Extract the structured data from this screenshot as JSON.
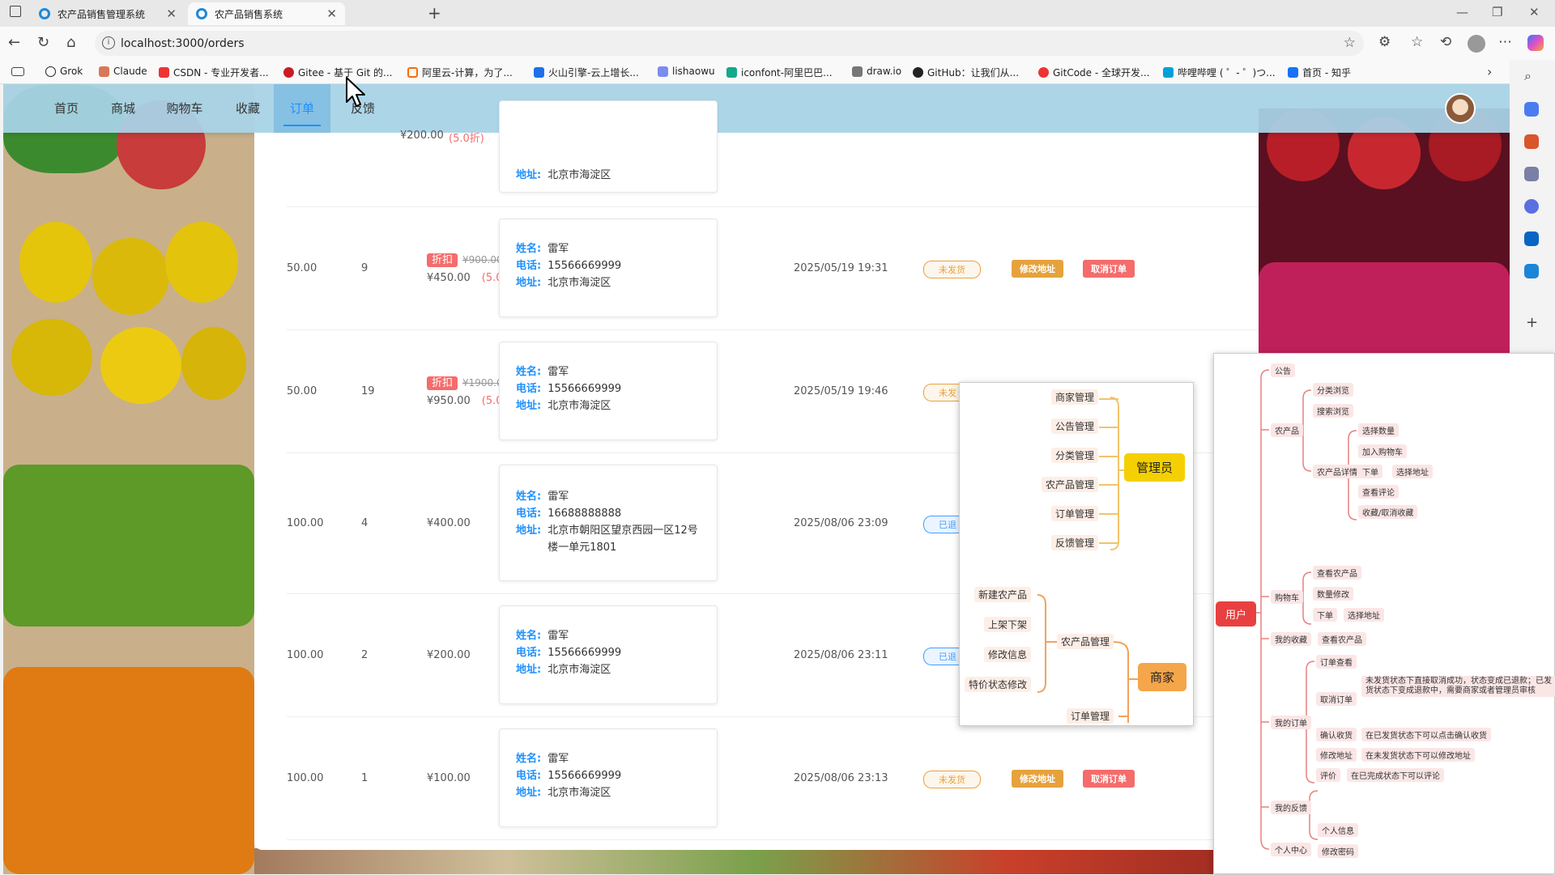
{
  "browser": {
    "tabs": [
      {
        "title": "农产品销售管理系统",
        "active": false
      },
      {
        "title": "农产品销售系统",
        "active": true
      }
    ],
    "url": "localhost:3000/orders",
    "bookmarks": [
      "Grok",
      "Claude",
      "CSDN - 专业开发者...",
      "Gitee - 基于 Git 的...",
      "阿里云-计算，为了...",
      "火山引擎-云上增长...",
      "lishaowu",
      "iconfont-阿里巴巴...",
      "draw.io",
      "GitHub：让我们从...",
      "GitCode - 全球开发...",
      "哔哩哔哩 ( ゜- ゜)つ...",
      "首页 - 知乎"
    ]
  },
  "nav": {
    "items": [
      "首页",
      "商城",
      "购物车",
      "收藏",
      "订单",
      "反馈"
    ],
    "active_index": 4
  },
  "orders": {
    "labels": {
      "name": "姓名:",
      "phone": "电话:",
      "address": "地址:"
    },
    "top_partial": {
      "price": "¥200.00",
      "rate": "(5.0折)",
      "address": "北京市海淀区"
    },
    "rows": [
      {
        "unit_price": "50.00",
        "qty": "9",
        "discount_tag": "折扣",
        "original": "¥900.00",
        "final": "¥450.00",
        "rate": "(5.0折)",
        "name": "雷军",
        "phone": "15566669999",
        "address": "北京市海淀区",
        "time": "2025/05/19 19:31",
        "status": "未发货",
        "status_type": "pending",
        "actions": [
          "修改地址",
          "取消订单"
        ]
      },
      {
        "unit_price": "50.00",
        "qty": "19",
        "discount_tag": "折扣",
        "original": "¥1900.00",
        "final": "¥950.00",
        "rate": "(5.0折)",
        "name": "雷军",
        "phone": "15566669999",
        "address": "北京市海淀区",
        "time": "2025/05/19 19:46",
        "status": "未发",
        "status_type": "pending",
        "actions": []
      },
      {
        "unit_price": "100.00",
        "qty": "4",
        "discount_tag": "",
        "original": "",
        "final": "¥400.00",
        "rate": "",
        "name": "雷军",
        "phone": "16688888888",
        "address": "北京市朝阳区望京西园一区12号楼一单元1801",
        "time": "2025/08/06 23:09",
        "status": "已退",
        "status_type": "returned",
        "actions": []
      },
      {
        "unit_price": "100.00",
        "qty": "2",
        "discount_tag": "",
        "original": "",
        "final": "¥200.00",
        "rate": "",
        "name": "雷军",
        "phone": "15566669999",
        "address": "北京市海淀区",
        "time": "2025/08/06 23:11",
        "status": "已退",
        "status_type": "returned",
        "actions": []
      },
      {
        "unit_price": "100.00",
        "qty": "1",
        "discount_tag": "",
        "original": "",
        "final": "¥100.00",
        "rate": "",
        "name": "雷军",
        "phone": "15566669999",
        "address": "北京市海淀区",
        "time": "2025/08/06 23:13",
        "status": "未发货",
        "status_type": "pending",
        "actions": [
          "修改地址",
          "取消订单"
        ]
      }
    ]
  },
  "mindmap_admin": {
    "admin_root": "管理员",
    "admin_children": [
      "商家管理",
      "公告管理",
      "分类管理",
      "农产品管理",
      "订单管理",
      "反馈管理"
    ],
    "merchant_root": "商家",
    "merchant_children": [
      "农产品管理",
      "订单管理"
    ],
    "product_children": [
      "新建农产品",
      "上架下架",
      "修改信息",
      "特价状态修改"
    ]
  },
  "mindmap_user": {
    "root": "用户",
    "nodes": {
      "notice": "公告",
      "products": "农产品",
      "browse_cat": "分类浏览",
      "browse_search": "搜索浏览",
      "detail": "农产品详情",
      "sel_qty": "选择数量",
      "add_cart": "加入购物车",
      "order": "下单",
      "sel_addr": "选择地址",
      "view_review": "查看评论",
      "fav": "收藏/取消收藏",
      "cart": "购物车",
      "cart_view": "查看农产品",
      "cart_qty": "数量修改",
      "cart_order": "下单",
      "cart_addr": "选择地址",
      "my_fav": "我的收藏",
      "fav_view": "查看农产品",
      "my_orders": "我的订单",
      "o_view": "订单查看",
      "o_cancel": "取消订单",
      "o_cancel_note": "未发货状态下直接取消成功，状态变成已退款；已发货状态下变成退款中，需要商家或者管理员审核",
      "o_confirm": "确认收货",
      "o_confirm_note": "在已发货状态下可以点击确认收货",
      "o_addr": "修改地址",
      "o_addr_note": "在未发货状态下可以修改地址",
      "o_review": "评价",
      "o_review_note": "在已完成状态下可以评论",
      "my_feedback": "我的反馈",
      "center": "个人中心",
      "info": "个人信息",
      "pwd": "修改密码"
    }
  },
  "colors": {
    "accent": "#1e90ff",
    "danger": "#f56c6c",
    "warning": "#e6a23c",
    "admin": "#f5d000",
    "merchant": "#f5a54a",
    "user": "#e84040"
  }
}
